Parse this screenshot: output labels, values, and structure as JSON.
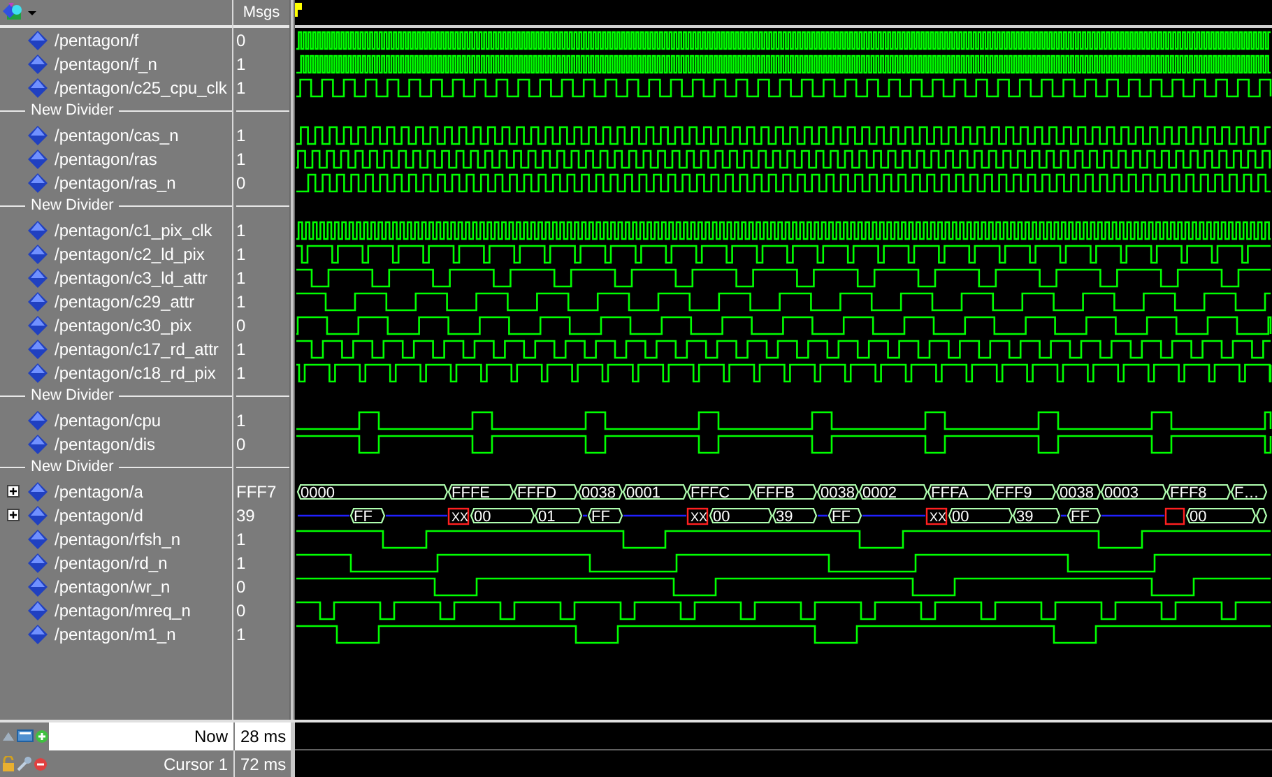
{
  "columns": {
    "values": "Msgs"
  },
  "rows": [
    {
      "kind": "signal",
      "name": "/pentagon/f",
      "value": "0"
    },
    {
      "kind": "signal",
      "name": "/pentagon/f_n",
      "value": "1"
    },
    {
      "kind": "signal",
      "name": "/pentagon/c25_cpu_clk",
      "value": "1"
    },
    {
      "kind": "divider",
      "name": "New Divider"
    },
    {
      "kind": "signal",
      "name": "/pentagon/cas_n",
      "value": "1"
    },
    {
      "kind": "signal",
      "name": "/pentagon/ras",
      "value": "1"
    },
    {
      "kind": "signal",
      "name": "/pentagon/ras_n",
      "value": "0"
    },
    {
      "kind": "divider",
      "name": "New Divider"
    },
    {
      "kind": "signal",
      "name": "/pentagon/c1_pix_clk",
      "value": "1"
    },
    {
      "kind": "signal",
      "name": "/pentagon/c2_ld_pix",
      "value": "1"
    },
    {
      "kind": "signal",
      "name": "/pentagon/c3_ld_attr",
      "value": "1"
    },
    {
      "kind": "signal",
      "name": "/pentagon/c29_attr",
      "value": "1"
    },
    {
      "kind": "signal",
      "name": "/pentagon/c30_pix",
      "value": "0"
    },
    {
      "kind": "signal",
      "name": "/pentagon/c17_rd_attr",
      "value": "1"
    },
    {
      "kind": "signal",
      "name": "/pentagon/c18_rd_pix",
      "value": "1"
    },
    {
      "kind": "divider",
      "name": "New Divider"
    },
    {
      "kind": "signal",
      "name": "/pentagon/cpu",
      "value": "1"
    },
    {
      "kind": "signal",
      "name": "/pentagon/dis",
      "value": "0"
    },
    {
      "kind": "divider",
      "name": "New Divider"
    },
    {
      "kind": "bus",
      "name": "/pentagon/a",
      "value": "FFF7",
      "expandable": true,
      "segments": [
        {
          "kind": "value",
          "label": "0000"
        },
        {
          "kind": "value",
          "label": "FFFE"
        },
        {
          "kind": "value",
          "label": "FFFD"
        },
        {
          "kind": "value",
          "label": "0038"
        },
        {
          "kind": "value",
          "label": "0001"
        },
        {
          "kind": "value",
          "label": "FFFC"
        },
        {
          "kind": "value",
          "label": "FFFB"
        },
        {
          "kind": "value",
          "label": "0038"
        },
        {
          "kind": "value",
          "label": "0002"
        },
        {
          "kind": "value",
          "label": "FFFA"
        },
        {
          "kind": "value",
          "label": "FFF9"
        },
        {
          "kind": "value",
          "label": "0038"
        },
        {
          "kind": "value",
          "label": "0003"
        },
        {
          "kind": "value",
          "label": "FFF8"
        },
        {
          "kind": "value",
          "label": "F…"
        }
      ]
    },
    {
      "kind": "bus",
      "name": "/pentagon/d",
      "value": "39",
      "expandable": true,
      "segments": [
        {
          "kind": "hiz"
        },
        {
          "kind": "value",
          "label": "FF"
        },
        {
          "kind": "hiz"
        },
        {
          "kind": "unknown",
          "label": "XX"
        },
        {
          "kind": "value",
          "label": "00"
        },
        {
          "kind": "value",
          "label": "01"
        },
        {
          "kind": "hiz"
        },
        {
          "kind": "value",
          "label": "FF"
        },
        {
          "kind": "hiz"
        },
        {
          "kind": "unknown",
          "label": "XX"
        },
        {
          "kind": "value",
          "label": "00"
        },
        {
          "kind": "value",
          "label": "39"
        },
        {
          "kind": "hiz"
        },
        {
          "kind": "value",
          "label": "FF"
        },
        {
          "kind": "hiz"
        },
        {
          "kind": "unknown",
          "label": "XX"
        },
        {
          "kind": "value",
          "label": "00"
        },
        {
          "kind": "value",
          "label": "39"
        },
        {
          "kind": "hiz"
        },
        {
          "kind": "value",
          "label": "FF"
        },
        {
          "kind": "hiz"
        },
        {
          "kind": "unknown"
        },
        {
          "kind": "value",
          "label": "00"
        },
        {
          "kind": "value"
        }
      ]
    },
    {
      "kind": "signal",
      "name": "/pentagon/rfsh_n",
      "value": "1"
    },
    {
      "kind": "signal",
      "name": "/pentagon/rd_n",
      "value": "1"
    },
    {
      "kind": "signal",
      "name": "/pentagon/wr_n",
      "value": "0"
    },
    {
      "kind": "signal",
      "name": "/pentagon/mreq_n",
      "value": "0"
    },
    {
      "kind": "signal",
      "name": "/pentagon/m1_n",
      "value": "1"
    }
  ],
  "now": {
    "label": "Now",
    "value": "28 ms"
  },
  "cursor": {
    "label": "Cursor 1",
    "value": "72 ms"
  }
}
